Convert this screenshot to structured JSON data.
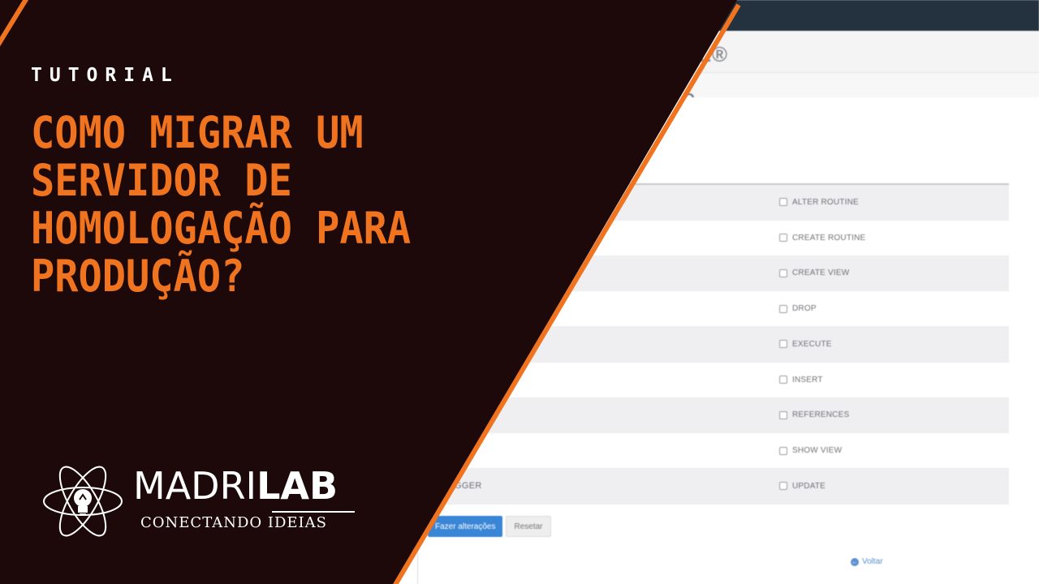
{
  "background_ui": {
    "header_title": "L®",
    "sub_title": "O",
    "privileges_left": [
      "",
      "",
      "",
      "",
      "",
      "",
      "",
      "",
      "GGER"
    ],
    "privileges_right": [
      "ALTER ROUTINE",
      "CREATE ROUTINE",
      "CREATE VIEW",
      "DROP",
      "EXECUTE",
      "INSERT",
      "REFERENCES",
      "SHOW VIEW",
      "UPDATE"
    ],
    "apply_button": "Fazer alterações",
    "reset_button": "Resetar",
    "back_link": "Voltar"
  },
  "overlay": {
    "tag": "TUTORIAL",
    "headline_lines": [
      "COMO MIGRAR UM",
      "SERVIDOR DE",
      "HOMOLOGAÇÃO PARA",
      "PRODUÇÃO?"
    ]
  },
  "logo": {
    "brand_part1": "MADRI",
    "brand_part2": "LAB",
    "tagline": "CONECTANDO IDEIAS"
  },
  "colors": {
    "overlay_dark": "#1d0909",
    "accent_orange": "#f0741f",
    "topbar": "#24323f",
    "apply_button": "#3a86d6"
  }
}
